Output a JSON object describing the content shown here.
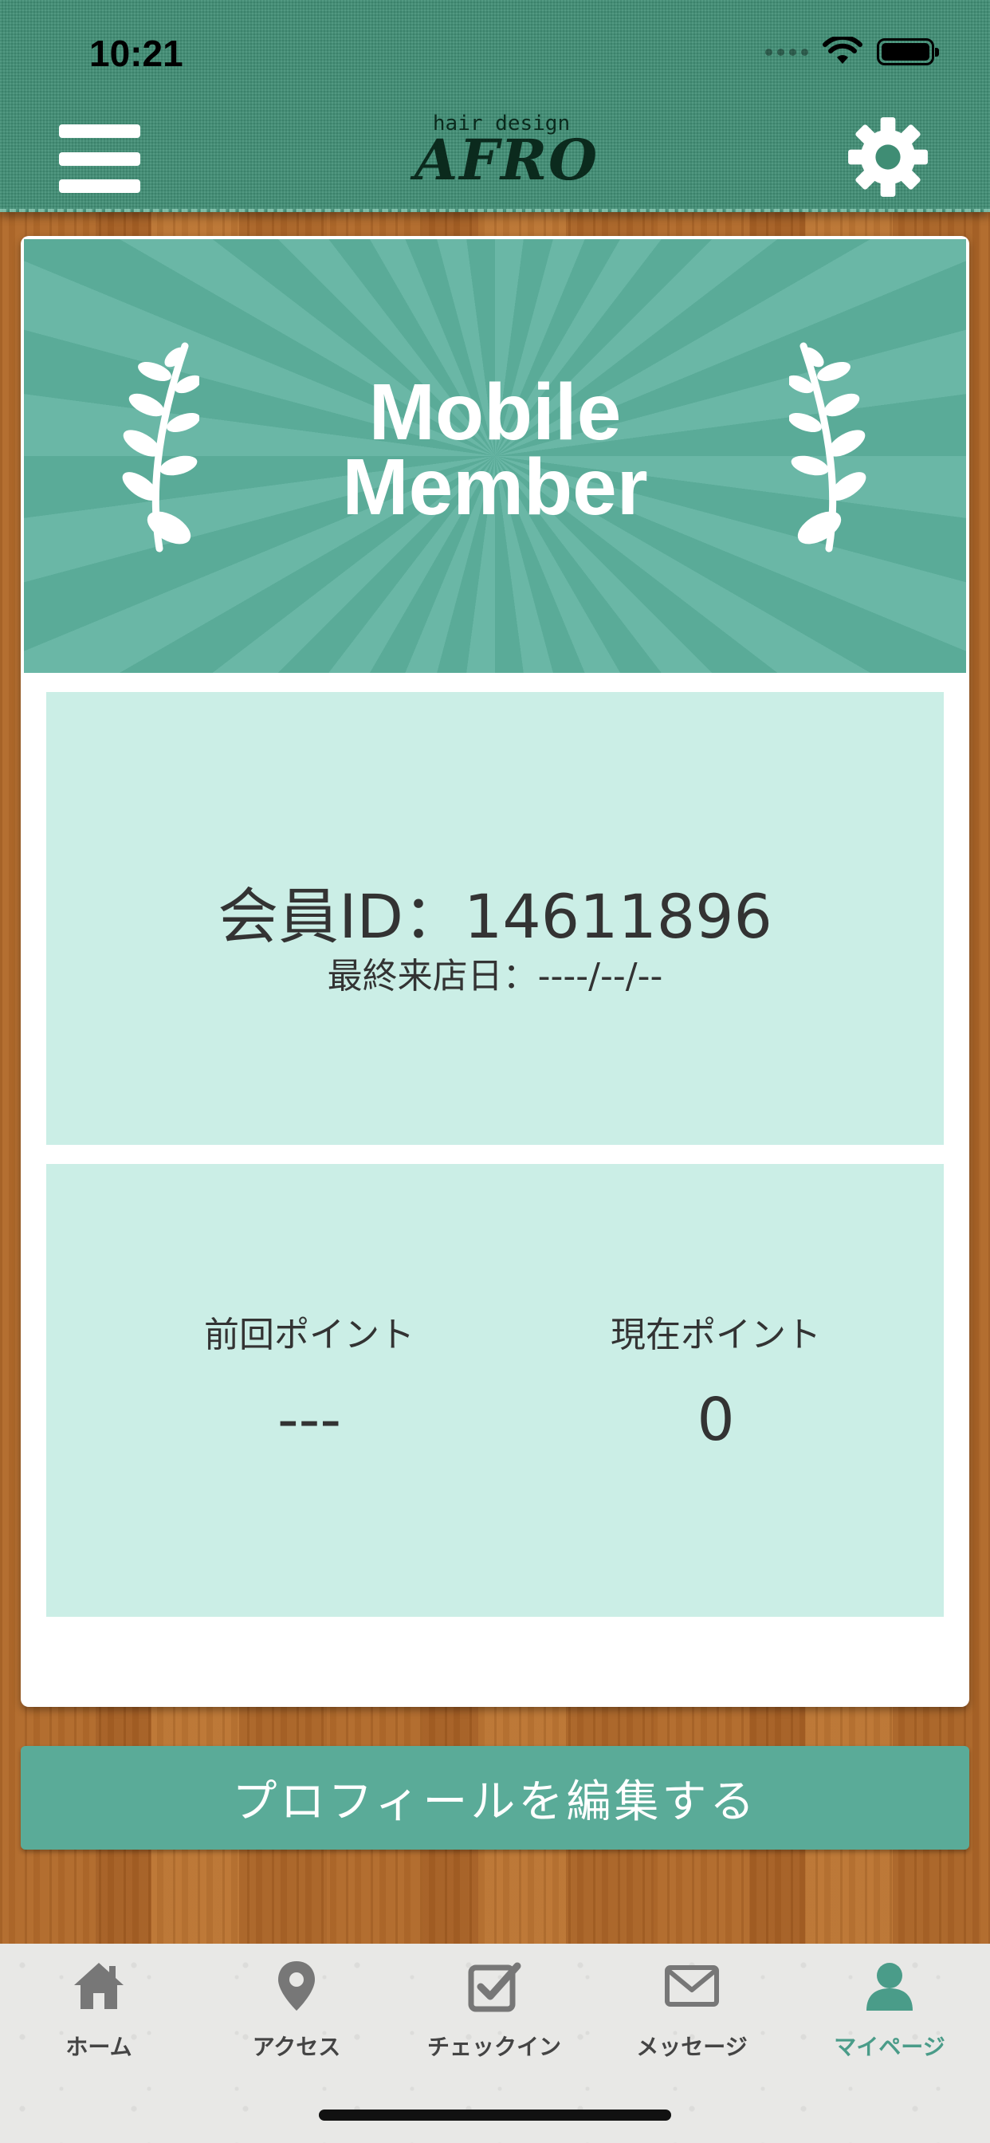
{
  "status_bar": {
    "time": "10:21"
  },
  "header": {
    "logo_small": "hair design",
    "logo_big": "AFRO",
    "menu_icon": "hamburger-menu-icon",
    "settings_icon": "gear-icon"
  },
  "banner": {
    "title_line1": "Mobile",
    "title_line2": "Member"
  },
  "member": {
    "id_label": "会員ID：14611896",
    "last_visit": "最終来店日：----/--/--"
  },
  "points": {
    "previous_label": "前回ポイント",
    "previous_value": "---",
    "current_label": "現在ポイント",
    "current_value": "0"
  },
  "edit_button": "プロフィールを編集する",
  "tabs": [
    {
      "label": "ホーム",
      "icon": "home-icon"
    },
    {
      "label": "アクセス",
      "icon": "map-pin-icon"
    },
    {
      "label": "チェックイン",
      "icon": "checkbox-icon"
    },
    {
      "label": "メッセージ",
      "icon": "envelope-icon"
    },
    {
      "label": "マイページ",
      "icon": "person-icon",
      "active": true
    }
  ],
  "colors": {
    "header_green": "#3f8d74",
    "banner_green": "#5aab98",
    "panel_mint": "#cbeee6",
    "active_tab": "#4a9c89"
  }
}
